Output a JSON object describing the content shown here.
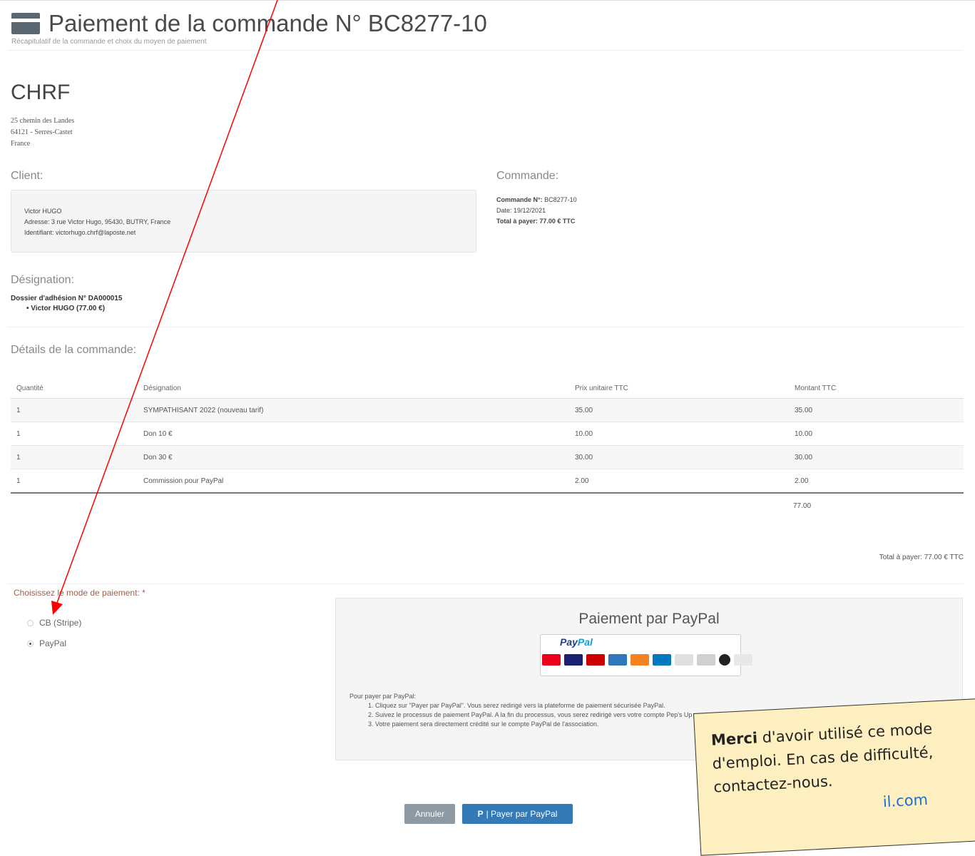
{
  "header": {
    "title": "Paiement de la commande N° BC8277-10",
    "subtitle": "Récapitulatif de la commande et choix du moyen de paiement"
  },
  "org": {
    "name": "CHRF",
    "address_lines": [
      "25 chemin des Landes",
      "64121 - Serres-Castet",
      "France"
    ]
  },
  "client": {
    "heading": "Client:",
    "name": "Victor HUGO",
    "address": "Adresse: 3 rue Victor Hugo, 95430, BUTRY, France",
    "identifier": "Identifiant: victorhugo.chrf@laposte.net"
  },
  "commande": {
    "heading": "Commande:",
    "number_label": "Commande N°:",
    "number": "BC8277-10",
    "date_label": "Date:",
    "date": "19/12/2021",
    "total_label": "Total à payer:",
    "total": "77.00 € TTC"
  },
  "designation": {
    "heading": "Désignation:",
    "dossier": "Dossier d'adhésion N° DA000015",
    "member": "Victor HUGO (77.00 €)"
  },
  "details": {
    "heading": "Détails de la commande:",
    "columns": [
      "Quantité",
      "Désignation",
      "Prix unitaire TTC",
      "Montant TTC"
    ],
    "rows": [
      [
        "1",
        "SYMPATHISANT 2022 (nouveau tarif)",
        "35.00",
        "35.00"
      ],
      [
        "1",
        "Don 10 €",
        "10.00",
        "10.00"
      ],
      [
        "1",
        "Don 30 €",
        "30.00",
        "30.00"
      ],
      [
        "1",
        "Commission pour PayPal",
        "2.00",
        "2.00"
      ]
    ],
    "total": "77.00",
    "total_pay": "Total à payer: 77.00 € TTC"
  },
  "payment": {
    "label": "Choisissez le mode de paiement: *",
    "options": [
      "CB (Stripe)",
      "PayPal"
    ],
    "selected": "PayPal",
    "box_title": "Paiement par PayPal",
    "logo_text_pay": "Pay",
    "logo_text_pal": "Pal",
    "instructions_title": "Pour payer par PayPal:",
    "steps": [
      "Cliquez sur \"Payer par PayPal\". Vous serez redirigé vers la plateforme de paiement sécurisée PayPal.",
      "Suivez le processus de paiement PayPal. A la fin du processus, vous serez redirigé vers votre compte Pep's Up",
      "Votre paiement sera directement crédité sur le compte PayPal de l'association."
    ]
  },
  "buttons": {
    "cancel": "Annuler",
    "pay": "| Payer par PayPal"
  },
  "note": {
    "bold": "Merci",
    "text": " d'avoir utilisé ce mode d'emploi. En cas de difficulté, contactez-nous.",
    "partial_link": "il.com"
  },
  "colors": {
    "annotation_arrow": "#ff0000",
    "note_background": "#fdefc0",
    "button_primary": "#337ab7",
    "button_secondary": "#8d9aa4"
  }
}
